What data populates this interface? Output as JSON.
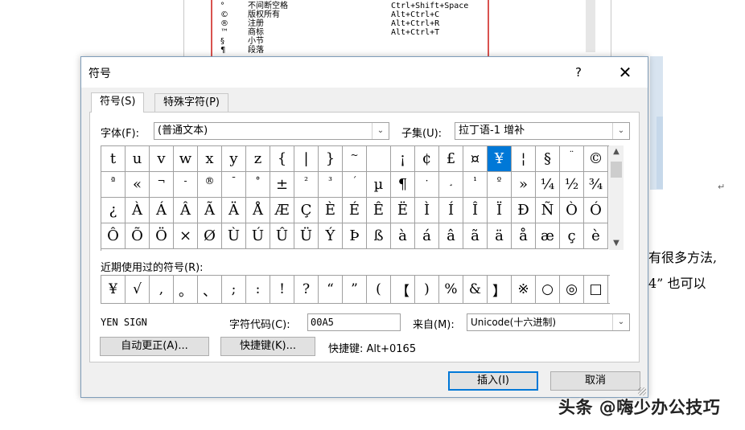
{
  "document": {
    "table_rows": [
      {
        "symbol": "°",
        "name": "不间断空格",
        "shortcut": "Ctrl+Shift+Space"
      },
      {
        "symbol": "©",
        "name": "版权所有",
        "shortcut": "Alt+Ctrl+C"
      },
      {
        "symbol": "®",
        "name": "注册",
        "shortcut": "Alt+Ctrl+R"
      },
      {
        "symbol": "™",
        "name": "商标",
        "shortcut": "Alt+Ctrl+T"
      },
      {
        "symbol": "§",
        "name": "小节",
        "shortcut": ""
      },
      {
        "symbol": "¶",
        "name": "段落",
        "shortcut": ""
      }
    ],
    "body_line1": "有很多方法,",
    "body_line2": "4” 也可以",
    "paragraph_mark": "↵",
    "watermark": "头条 @嗨少办公技巧"
  },
  "dialog": {
    "title": "符号",
    "help": "?",
    "close": "✕",
    "tabs": [
      "符号(S)",
      "特殊字符(P)"
    ],
    "font_label": "字体(F):",
    "font_value": "(普通文本)",
    "subset_label": "子集(U):",
    "subset_value": "拉丁语-1 增补",
    "symbols": [
      [
        "t",
        "u",
        "v",
        "w",
        "x",
        "y",
        "z",
        "{",
        "|",
        "}",
        "~",
        "",
        "¡",
        "¢",
        "£",
        "¤",
        "¥",
        "¦",
        "§",
        "¨",
        "©"
      ],
      [
        "ª",
        "«",
        "¬",
        "-",
        "®",
        "¯",
        "°",
        "±",
        "²",
        "³",
        "´",
        "µ",
        "¶",
        "·",
        "¸",
        "¹",
        "º",
        "»",
        "¼",
        "½",
        "¾"
      ],
      [
        "¿",
        "À",
        "Á",
        "Â",
        "Ã",
        "Ä",
        "Å",
        "Æ",
        "Ç",
        "È",
        "É",
        "Ê",
        "Ë",
        "Ì",
        "Í",
        "Î",
        "Ï",
        "Ð",
        "Ñ",
        "Ò",
        "Ó"
      ],
      [
        "Ô",
        "Õ",
        "Ö",
        "×",
        "Ø",
        "Ù",
        "Ú",
        "Û",
        "Ü",
        "Ý",
        "Þ",
        "ß",
        "à",
        "á",
        "â",
        "ã",
        "ä",
        "å",
        "æ",
        "ç",
        "è"
      ]
    ],
    "selected_symbol": "¥",
    "recent_label": "近期使用过的符号(R):",
    "recent": [
      "¥",
      "√",
      ",",
      "。",
      "、",
      ";",
      ":",
      "!",
      "?",
      "“",
      "”",
      "(",
      "【",
      ")",
      "%",
      "&",
      "】",
      "※",
      "○",
      "◎",
      "□"
    ],
    "char_name": "YEN SIGN",
    "code_label": "字符代码(C):",
    "code_value": "00A5",
    "from_label": "来自(M):",
    "from_value": "Unicode(十六进制)",
    "autocorrect": "自动更正(A)...",
    "shortcut_key_button": "快捷键(K)...",
    "shortcut_info": "快捷键: Alt+0165",
    "insert": "插入(I)",
    "cancel": "取消"
  },
  "colors": {
    "selection": "#0078d7",
    "table_border": "#d9534f"
  }
}
